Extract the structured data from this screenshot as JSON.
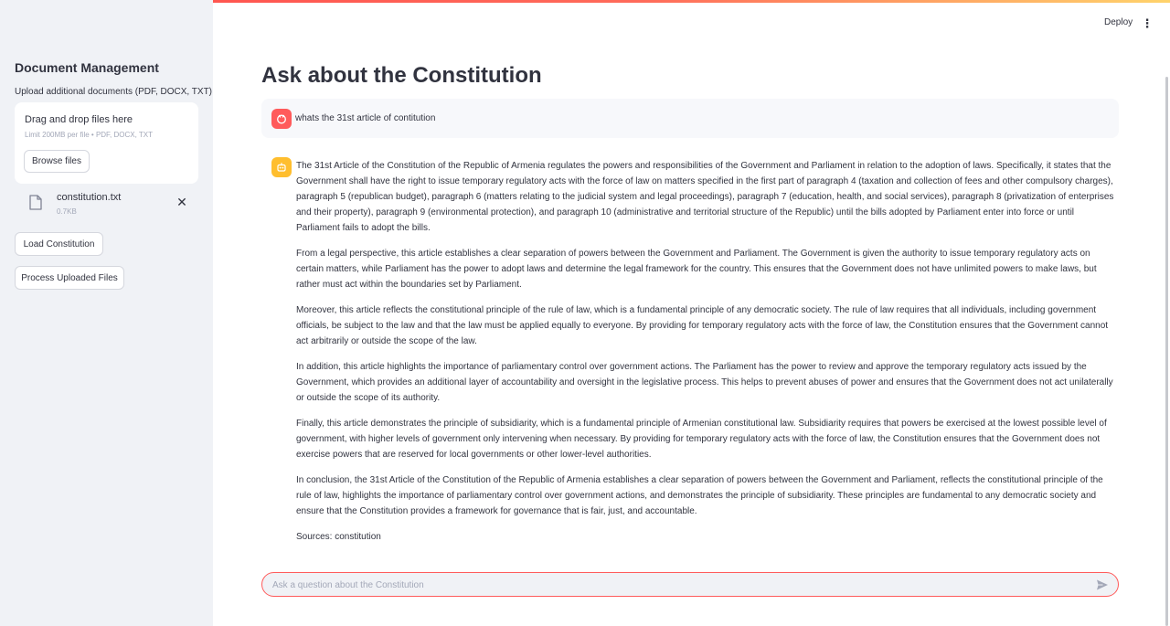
{
  "header": {
    "deploy_label": "Deploy",
    "menu_icon": "kebab-menu-icon"
  },
  "sidebar": {
    "title": "Document Management",
    "upload_label": "Upload additional documents (PDF, DOCX, TXT)",
    "dropzone": {
      "title": "Drag and drop files here",
      "limit": "Limit 200MB per file • PDF, DOCX, TXT",
      "browse_label": "Browse files"
    },
    "file": {
      "name": "constitution.txt",
      "size": "0.7KB",
      "icon": "file-icon"
    },
    "load_button": "Load Constitution",
    "process_button": "Process Uploaded Files"
  },
  "main": {
    "title": "Ask about the Constitution",
    "user_message": "whats the 31st article of contitution",
    "assistant_paragraphs": [
      "The 31st Article of the Constitution of the Republic of Armenia regulates the powers and responsibilities of the Government and Parliament in relation to the adoption of laws. Specifically, it states that the Government shall have the right to issue temporary regulatory acts with the force of law on matters specified in the first part of paragraph 4 (taxation and collection of fees and other compulsory charges), paragraph 5 (republican budget), paragraph 6 (matters relating to the judicial system and legal proceedings), paragraph 7 (education, health, and social services), paragraph 8 (privatization of enterprises and their property), paragraph 9 (environmental protection), and paragraph 10 (administrative and territorial structure of the Republic) until the bills adopted by Parliament enter into force or until Parliament fails to adopt the bills.",
      "From a legal perspective, this article establishes a clear separation of powers between the Government and Parliament. The Government is given the authority to issue temporary regulatory acts on certain matters, while Parliament has the power to adopt laws and determine the legal framework for the country. This ensures that the Government does not have unlimited powers to make laws, but rather must act within the boundaries set by Parliament.",
      "Moreover, this article reflects the constitutional principle of the rule of law, which is a fundamental principle of any democratic society. The rule of law requires that all individuals, including government officials, be subject to the law and that the law must be applied equally to everyone. By providing for temporary regulatory acts with the force of law, the Constitution ensures that the Government cannot act arbitrarily or outside the scope of the law.",
      "In addition, this article highlights the importance of parliamentary control over government actions. The Parliament has the power to review and approve the temporary regulatory acts issued by the Government, which provides an additional layer of accountability and oversight in the legislative process. This helps to prevent abuses of power and ensures that the Government does not act unilaterally or outside the scope of its authority.",
      "Finally, this article demonstrates the principle of subsidiarity, which is a fundamental principle of Armenian constitutional law. Subsidiarity requires that powers be exercised at the lowest possible level of government, with higher levels of government only intervening when necessary. By providing for temporary regulatory acts with the force of law, the Constitution ensures that the Government does not exercise powers that are reserved for local governments or other lower-level authorities.",
      "In conclusion, the 31st Article of the Constitution of the Republic of Armenia establishes a clear separation of powers between the Government and Parliament, reflects the constitutional principle of the rule of law, highlights the importance of parliamentary control over government actions, and demonstrates the principle of subsidiarity. These principles are fundamental to any democratic society and ensure that the Constitution provides a framework for governance that is fair, just, and accountable."
    ],
    "sources": "Sources: constitution",
    "chat_placeholder": "Ask a question about the Constitution"
  },
  "colors": {
    "accent": "#ff4b4b",
    "sidebar_bg": "#f0f2f6",
    "user_avatar": "#ff5b5b",
    "assistant_avatar": "#ffbe2e"
  }
}
